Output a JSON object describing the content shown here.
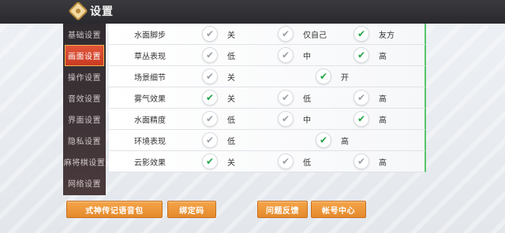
{
  "page": {
    "title": "设置"
  },
  "sidebar": {
    "items": [
      {
        "label": "基础设置",
        "active": false
      },
      {
        "label": "画面设置",
        "active": true
      },
      {
        "label": "操作设置",
        "active": false
      },
      {
        "label": "音效设置",
        "active": false
      },
      {
        "label": "界面设置",
        "active": false
      },
      {
        "label": "隐私设置",
        "active": false
      },
      {
        "label": "麻将棋设置",
        "active": false
      },
      {
        "label": "网络设置",
        "active": false
      }
    ]
  },
  "settings": {
    "rows": [
      {
        "label": "水面脚步",
        "options": [
          {
            "label": "关",
            "selected": false
          },
          {
            "label": "仅自己",
            "selected": false
          },
          {
            "label": "友方",
            "selected": true
          }
        ]
      },
      {
        "label": "草丛表现",
        "options": [
          {
            "label": "低",
            "selected": false
          },
          {
            "label": "中",
            "selected": false
          },
          {
            "label": "高",
            "selected": true
          }
        ]
      },
      {
        "label": "场景细节",
        "options": [
          {
            "label": "关",
            "selected": false
          },
          {
            "label": "开",
            "selected": true
          }
        ]
      },
      {
        "label": "雾气效果",
        "options": [
          {
            "label": "关",
            "selected": true
          },
          {
            "label": "低",
            "selected": false
          },
          {
            "label": "高",
            "selected": false
          }
        ]
      },
      {
        "label": "水面精度",
        "options": [
          {
            "label": "低",
            "selected": false
          },
          {
            "label": "中",
            "selected": false
          },
          {
            "label": "高",
            "selected": true
          }
        ]
      },
      {
        "label": "环境表现",
        "options": [
          {
            "label": "低",
            "selected": false
          },
          {
            "label": "高",
            "selected": true
          }
        ]
      },
      {
        "label": "云影效果",
        "options": [
          {
            "label": "关",
            "selected": true
          },
          {
            "label": "低",
            "selected": false
          },
          {
            "label": "高",
            "selected": false
          }
        ]
      }
    ]
  },
  "buttons": {
    "voice_pack": "式神传记语音包",
    "bind_code": "绑定码",
    "feedback": "问题反馈",
    "account_center": "帐号中心"
  },
  "colors": {
    "check_on": "#22a447",
    "check_off": "#9aa0a6",
    "active_tab": "#d9452b",
    "button": "#ec9638"
  }
}
